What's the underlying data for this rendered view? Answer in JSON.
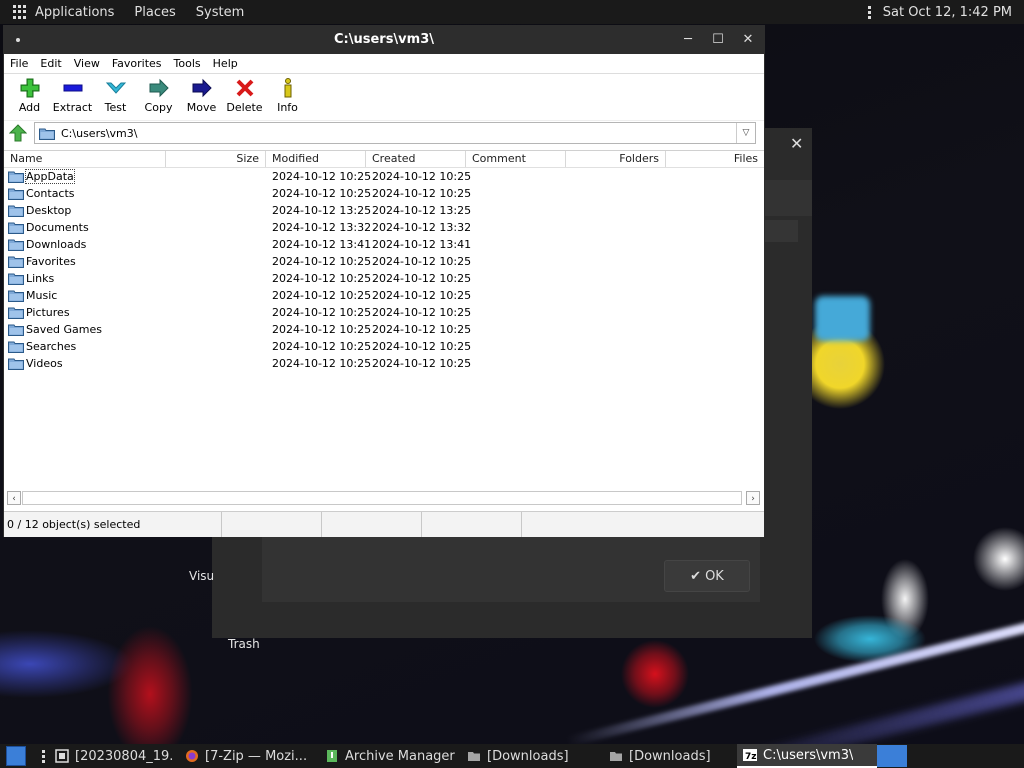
{
  "top_panel": {
    "applications": "Applications",
    "places": "Places",
    "system": "System",
    "clock": "Sat Oct 12,  1:42 PM"
  },
  "desktop": {
    "label_visu": "Visu",
    "label_trash": "Trash"
  },
  "bg_dialog": {
    "ok_label": "OK"
  },
  "window": {
    "title": "C:\\users\\vm3\\",
    "menu": [
      "File",
      "Edit",
      "View",
      "Favorites",
      "Tools",
      "Help"
    ],
    "toolbar": [
      {
        "label": "Add",
        "icon": "plus-icon",
        "color": "#2fa52f"
      },
      {
        "label": "Extract",
        "icon": "minus-icon",
        "color": "#1a1adb"
      },
      {
        "label": "Test",
        "icon": "check-icon",
        "color": "#34b8d8"
      },
      {
        "label": "Copy",
        "icon": "double-arrow-icon",
        "color": "#3a8a7c"
      },
      {
        "label": "Move",
        "icon": "arrow-right-icon",
        "color": "#1a1a90"
      },
      {
        "label": "Delete",
        "icon": "x-icon",
        "color": "#d81a1a"
      },
      {
        "label": "Info",
        "icon": "info-icon",
        "color": "#d8c81a"
      }
    ],
    "address": "C:\\users\\vm3\\",
    "columns": [
      "Name",
      "Size",
      "Modified",
      "Created",
      "Comment",
      "Folders",
      "Files"
    ],
    "rows": [
      {
        "name": "AppData",
        "modified": "2024-10-12 10:25",
        "created": "2024-10-12 10:25"
      },
      {
        "name": "Contacts",
        "modified": "2024-10-12 10:25",
        "created": "2024-10-12 10:25"
      },
      {
        "name": "Desktop",
        "modified": "2024-10-12 13:25",
        "created": "2024-10-12 13:25"
      },
      {
        "name": "Documents",
        "modified": "2024-10-12 13:32",
        "created": "2024-10-12 13:32"
      },
      {
        "name": "Downloads",
        "modified": "2024-10-12 13:41",
        "created": "2024-10-12 13:41"
      },
      {
        "name": "Favorites",
        "modified": "2024-10-12 10:25",
        "created": "2024-10-12 10:25"
      },
      {
        "name": "Links",
        "modified": "2024-10-12 10:25",
        "created": "2024-10-12 10:25"
      },
      {
        "name": "Music",
        "modified": "2024-10-12 10:25",
        "created": "2024-10-12 10:25"
      },
      {
        "name": "Pictures",
        "modified": "2024-10-12 10:25",
        "created": "2024-10-12 10:25"
      },
      {
        "name": "Saved Games",
        "modified": "2024-10-12 10:25",
        "created": "2024-10-12 10:25"
      },
      {
        "name": "Searches",
        "modified": "2024-10-12 10:25",
        "created": "2024-10-12 10:25"
      },
      {
        "name": "Videos",
        "modified": "2024-10-12 10:25",
        "created": "2024-10-12 10:25"
      }
    ],
    "status": "0 / 12 object(s) selected"
  },
  "taskbar": [
    {
      "label": "[20230804_19...",
      "icon": "terminal-icon"
    },
    {
      "label": "[7-Zip — Mozi...",
      "icon": "firefox-icon"
    },
    {
      "label": "Archive Manager",
      "icon": "archive-icon"
    },
    {
      "label": "[Downloads]",
      "icon": "folder-icon"
    },
    {
      "label": "[Downloads]",
      "icon": "folder-icon"
    },
    {
      "label": "C:\\users\\vm3\\",
      "icon": "7zip-icon",
      "active": true
    }
  ]
}
